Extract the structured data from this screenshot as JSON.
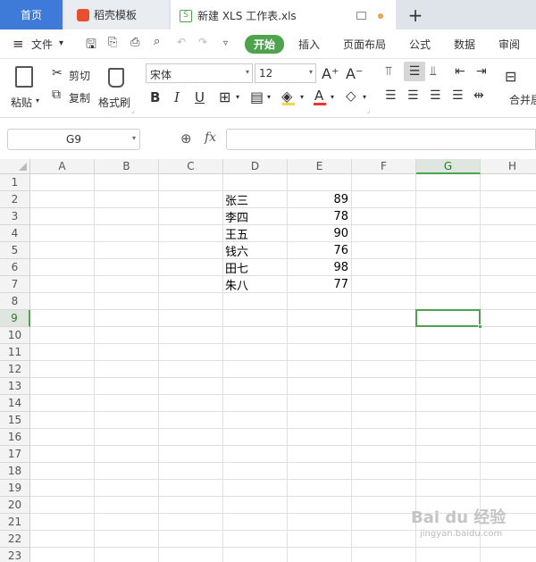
{
  "tabs": {
    "home": "首页",
    "template": "稻壳模板",
    "doc": "新建 XLS 工作表.xls",
    "add": "+"
  },
  "menu": {
    "file": "文件",
    "start": "开始",
    "insert": "插入",
    "layout": "页面布局",
    "formula": "公式",
    "data": "数据",
    "review": "审阅"
  },
  "ribbon": {
    "paste": "粘贴",
    "cut": "剪切",
    "copy": "复制",
    "format_painter": "格式刷",
    "font": "宋体",
    "size": "12",
    "merge": "合并居"
  },
  "formula_bar": {
    "name_box": "G9",
    "fx": "fx",
    "content": ""
  },
  "sheet": {
    "columns": [
      "A",
      "B",
      "C",
      "D",
      "E",
      "F",
      "G",
      "H"
    ],
    "rows": [
      "1",
      "2",
      "3",
      "4",
      "5",
      "6",
      "7",
      "8",
      "9",
      "10",
      "11",
      "12",
      "13",
      "14",
      "15",
      "16",
      "17",
      "18",
      "19",
      "20",
      "21",
      "22",
      "23"
    ],
    "selected_cell": "G9",
    "data": [
      {
        "name": "张三",
        "score": "89"
      },
      {
        "name": "李四",
        "score": "78"
      },
      {
        "name": "王五",
        "score": "90"
      },
      {
        "name": "钱六",
        "score": "76"
      },
      {
        "name": "田七",
        "score": "98"
      },
      {
        "name": "朱八",
        "score": "77"
      }
    ]
  },
  "watermark": {
    "brand": "Bai du 经验",
    "url": "jingyan.baidu.com"
  },
  "colors": {
    "accent": "#4fa34f",
    "tab_home": "#3e7bd9",
    "selection": "#4fa34f"
  }
}
